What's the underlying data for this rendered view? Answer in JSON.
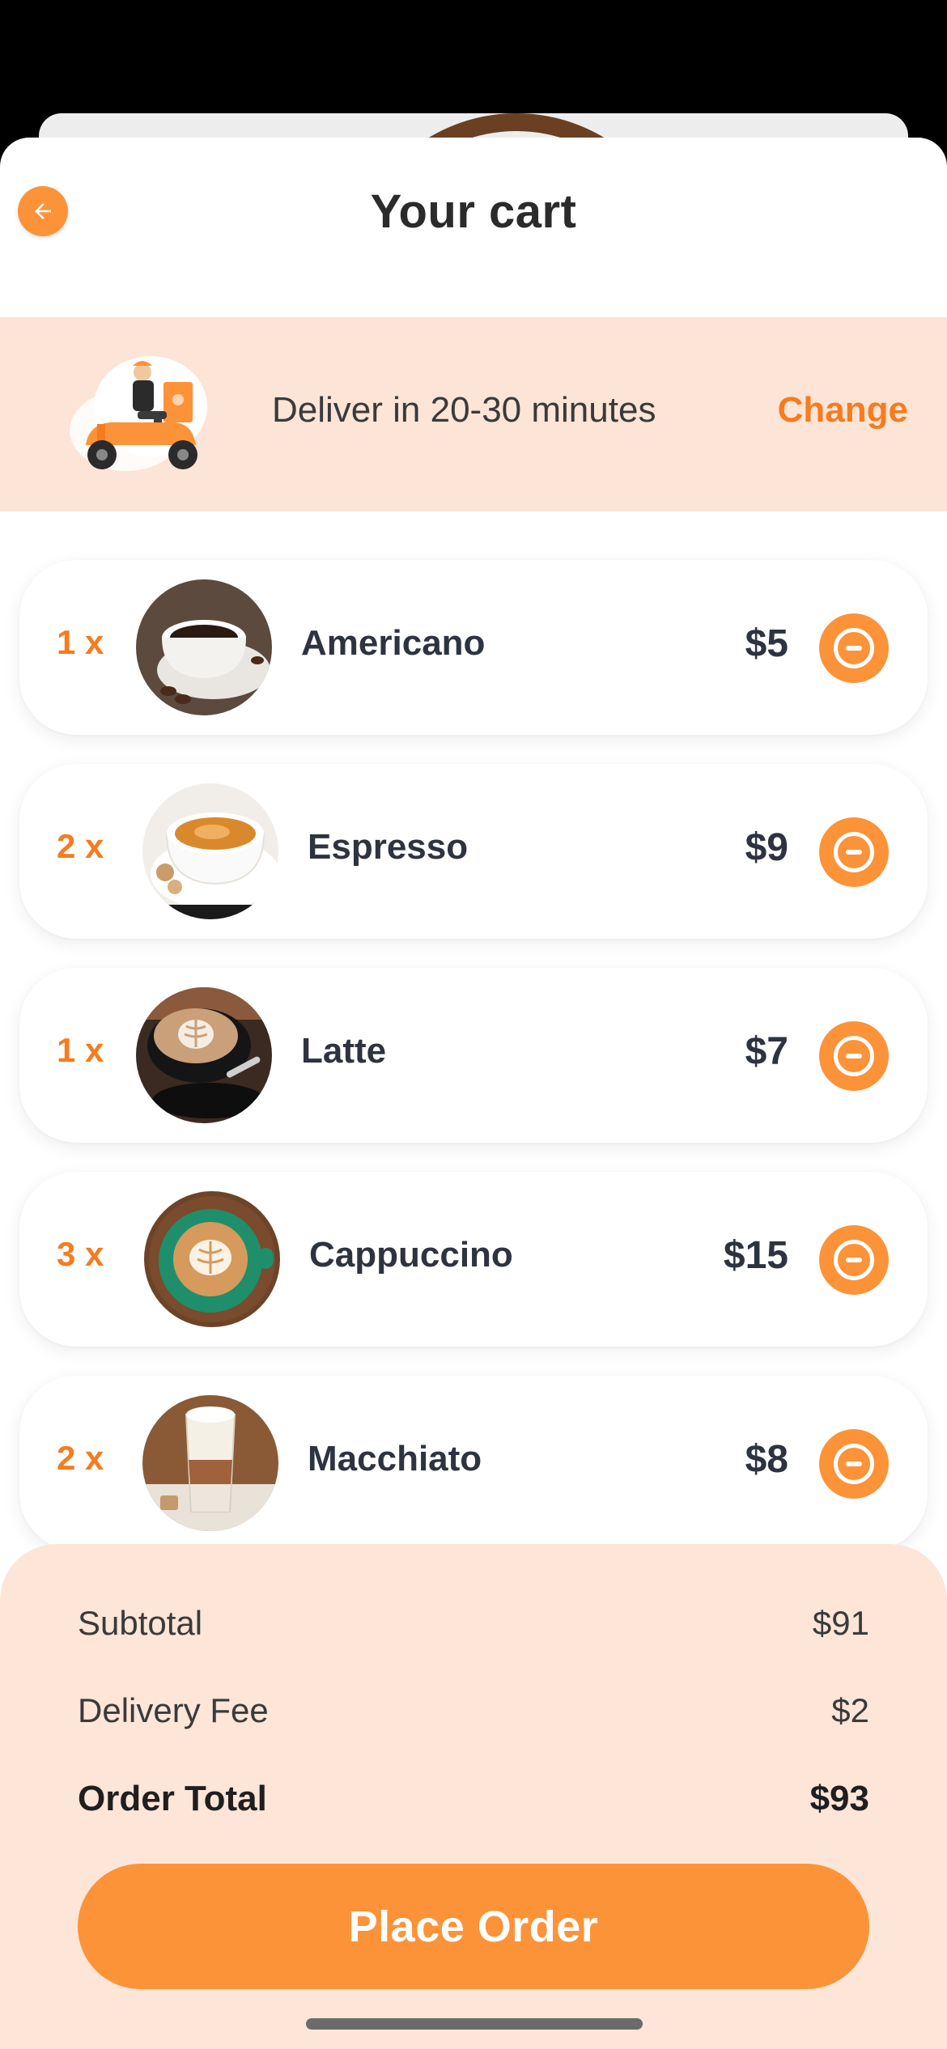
{
  "header": {
    "title": "Your cart",
    "back_icon": "arrow-left-icon"
  },
  "delivery": {
    "text": "Deliver in 20-30 minutes",
    "change_label": "Change",
    "illustration": "delivery-scooter-illustration"
  },
  "cart_items": [
    {
      "qty": "1 x",
      "name": "Americano",
      "price": "$5",
      "image": "americano-photo"
    },
    {
      "qty": "2 x",
      "name": "Espresso",
      "price": "$9",
      "image": "espresso-photo"
    },
    {
      "qty": "1 x",
      "name": "Latte",
      "price": "$7",
      "image": "latte-photo"
    },
    {
      "qty": "3 x",
      "name": "Cappuccino",
      "price": "$15",
      "image": "cappuccino-photo"
    },
    {
      "qty": "2 x",
      "name": "Macchiato",
      "price": "$8",
      "image": "macchiato-photo"
    }
  ],
  "summary": {
    "subtotal_label": "Subtotal",
    "subtotal_value": "$91",
    "delivery_fee_label": "Delivery Fee",
    "delivery_fee_value": "$2",
    "order_total_label": "Order Total",
    "order_total_value": "$93"
  },
  "place_order_label": "Place Order",
  "colors": {
    "accent": "#fc9339",
    "accent_text": "#f57c1f",
    "delivery_band": "#fce4d6",
    "summary_bg": "#fde5d7",
    "text_dark": "#2e3340"
  },
  "icons": {
    "remove": "minus-circle-icon"
  }
}
